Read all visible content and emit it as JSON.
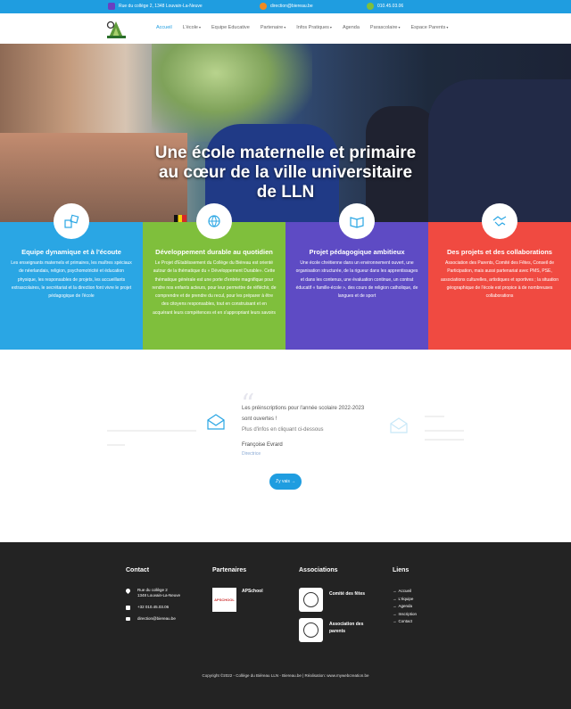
{
  "topbar": {
    "address": "Rue du collège 2, 1348 Louvain-La-Neuve",
    "email": "direction@biereau.be",
    "phone": "010.45.03.06"
  },
  "nav": {
    "items": [
      {
        "label": "Accueil"
      },
      {
        "label": "L'école"
      },
      {
        "label": "Equipe Educative"
      },
      {
        "label": "Partenaire"
      },
      {
        "label": "Infos Pratiques"
      },
      {
        "label": "Agenda"
      },
      {
        "label": "Parascolaire"
      },
      {
        "label": "Espace Parents"
      }
    ]
  },
  "hero": {
    "title": "Une école maternelle et primaire au cœur de la ville universitaire de LLN"
  },
  "features": [
    {
      "title": "Equipe dynamique et à l'écoute",
      "text": "Les enseignants maternels et primaires, les maîtres spéciaux de néerlandais, religion, psychomotricité et éducation physique, les responsables de projets, les accueillants extrascolaires, le secrétariat et la direction font vivre le projet pédagogique de l'école",
      "color": "#2aa6e4"
    },
    {
      "title": "Développement durable au quotidien",
      "text": "Le Projet d'Etablissement du Collège du Biéreau est orienté autour de la thématique du « Développement Durable». Cette thématique générale est une porte d'entrée magnifique pour rendre nos enfants acteurs, pour leur permettre de réfléchir, de comprendre et de prendre du recul, pour les préparer à être des citoyens responsables, tout en construisant et en acquérant leurs compétences et en s'appropriant leurs savoirs",
      "color": "#7fbf3c"
    },
    {
      "title": "Projet pédagogique ambitieux",
      "text": "Une école chrétienne dans un environnement ouvert, une organisation structurée, de la rigueur dans les apprentissages et dans les contenus, une évaluation continue, un contrat éducatif « famille-école », des cours de religion catholique, de langues et de sport",
      "color": "#5e4bc4"
    },
    {
      "title": "Des projets et des collaborations",
      "text": "Association des Parents, Comité des Fêtes, Conseil de Participation, mais aussi partenariat avec PMS, PSE, associations culturelles, artistiques et sportives ; la situation géographique de l'école est propice à de nombreuses collaborations",
      "color": "#f04a41"
    }
  ],
  "testimonial": {
    "text": "Les préinscriptions pour l'année scolaire 2022-2023 sont ouvertes !",
    "more": "Plus d'infos en cliquant ci-dessous",
    "name": "Françoise Evrard",
    "role": "Directrice",
    "cta": "J'y vais"
  },
  "footer": {
    "contact": {
      "title": "Contact",
      "address_line1": "Rue du collège 2",
      "address_line2": "1348 Louvain-La-Neuve",
      "phone": "+32 010.45.03.06",
      "email": "direction@biereau.be"
    },
    "partners": {
      "title": "Partenaires",
      "items": [
        {
          "name": "APSchool",
          "logo_text": "APSCHOOL"
        }
      ]
    },
    "associations": {
      "title": "Associations",
      "items": [
        {
          "name": "Comité des fêtes"
        },
        {
          "name": "Association des parents"
        }
      ]
    },
    "links": {
      "title": "Liens",
      "items": [
        "Accueil",
        "L'équipe",
        "Agenda",
        "Inscription",
        "Contact"
      ]
    },
    "copyright": "Copyright ©2022 - Collège du Biéreau LLN - Biereau.be | Réalisation: www.mywebcreation.be"
  }
}
